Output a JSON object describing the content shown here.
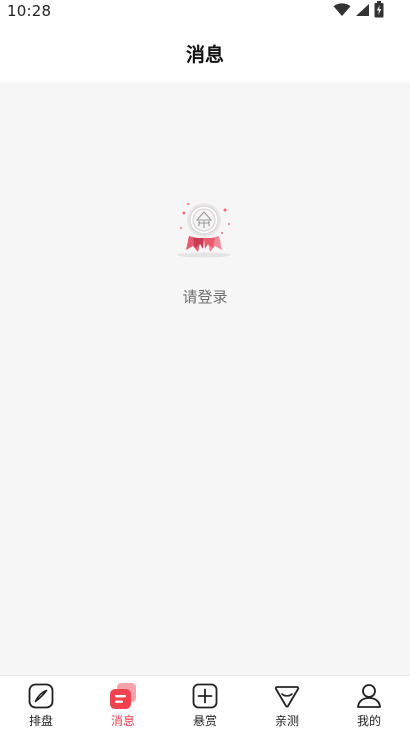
{
  "status_bar": {
    "time": "10:28",
    "icons": [
      "wifi-icon",
      "signal-icon",
      "battery-icon"
    ]
  },
  "header": {
    "title": "消息"
  },
  "empty_state": {
    "icon": "ribbon-medal-icon",
    "message": "请登录"
  },
  "tabbar": {
    "active_color": "#f0424f",
    "items": [
      {
        "label": "排盘",
        "icon": "compass-icon",
        "active": false
      },
      {
        "label": "消息",
        "icon": "message-icon",
        "active": true
      },
      {
        "label": "悬赏",
        "icon": "plus-square-icon",
        "active": false
      },
      {
        "label": "亲测",
        "icon": "shield-heart-icon",
        "active": false
      },
      {
        "label": "我的",
        "icon": "user-icon",
        "active": false
      }
    ]
  }
}
